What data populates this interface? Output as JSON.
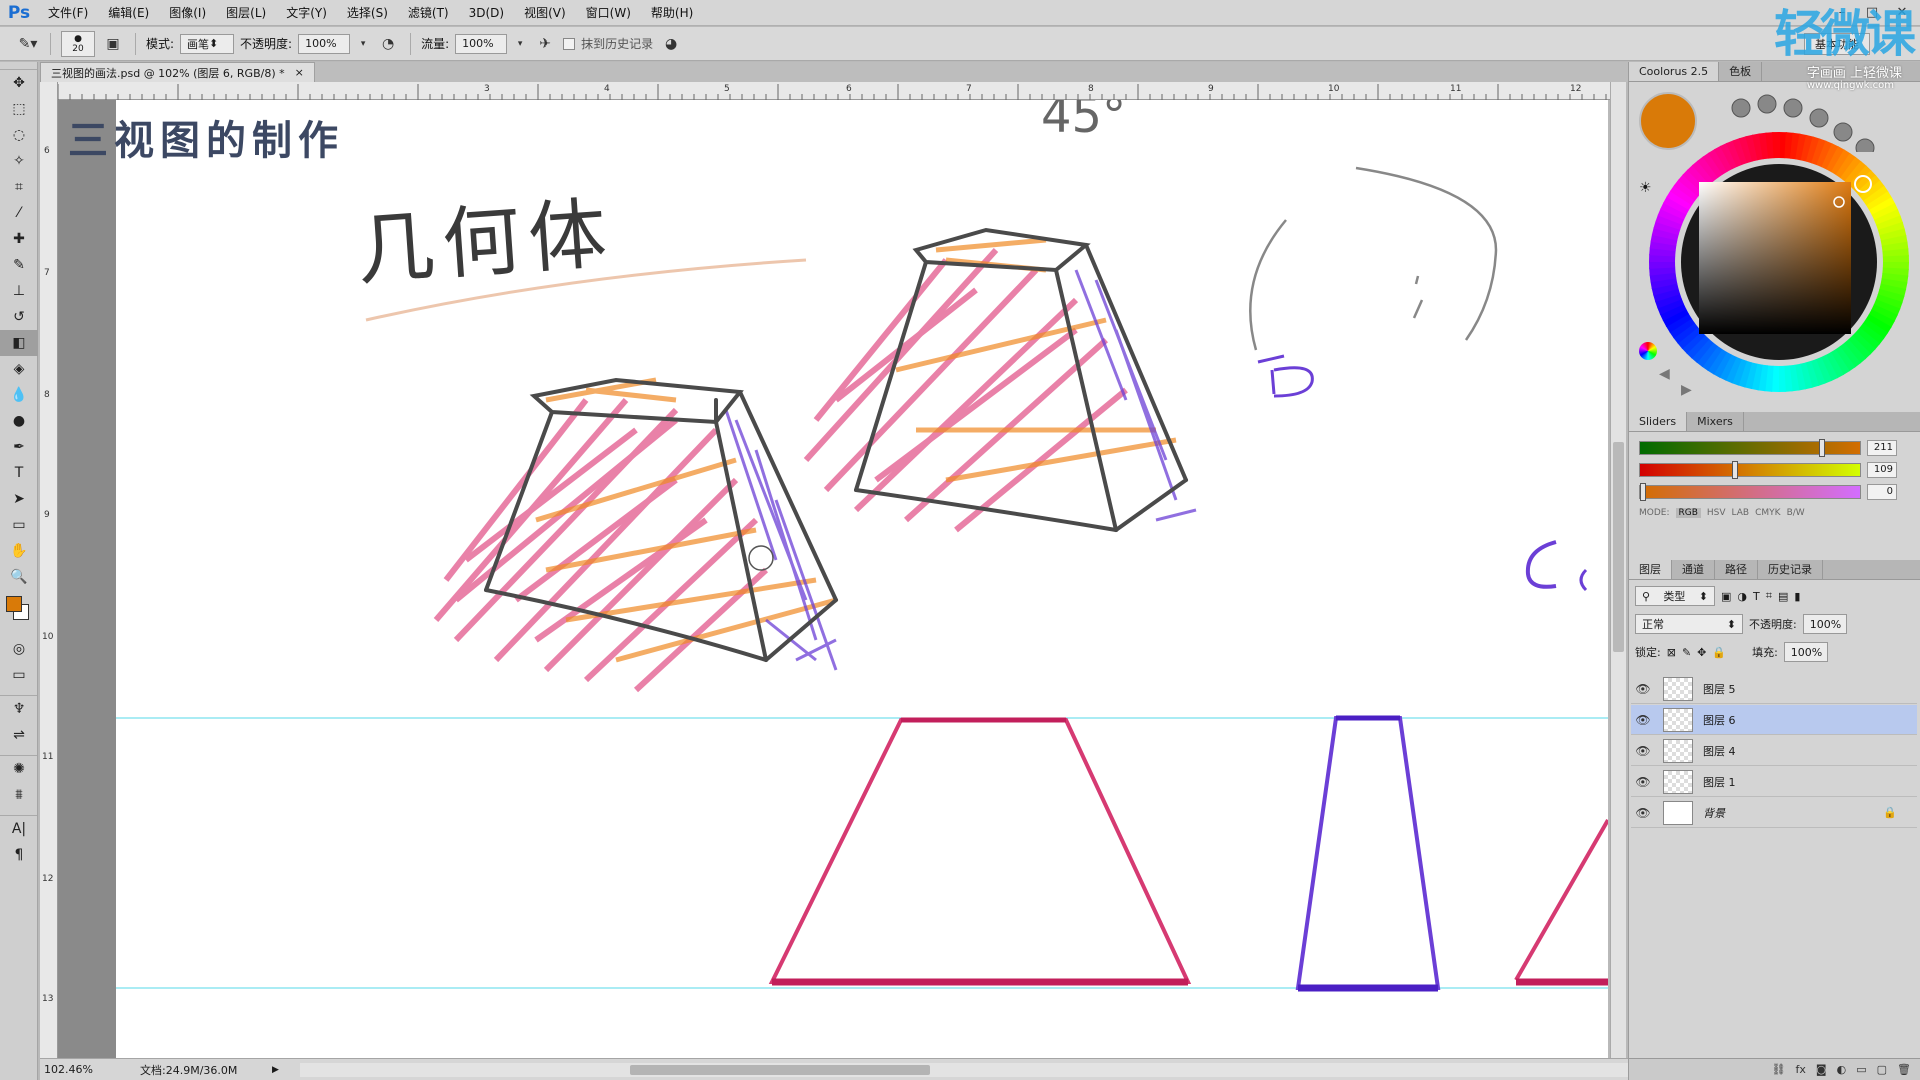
{
  "app": {
    "logo": "Ps"
  },
  "menu": [
    "文件(F)",
    "编辑(E)",
    "图像(I)",
    "图层(L)",
    "文字(Y)",
    "选择(S)",
    "滤镜(T)",
    "3D(D)",
    "视图(V)",
    "窗口(W)",
    "帮助(H)"
  ],
  "options": {
    "brush_size": "20",
    "mode_label": "模式:",
    "mode_value": "画笔",
    "opacity_label": "不透明度:",
    "opacity_value": "100%",
    "flow_label": "流量:",
    "flow_value": "100%",
    "history_label": "抹到历史记录",
    "workspace": "基本功能"
  },
  "document": {
    "tab_title": "三视图的画法.psd @ 102% (图层 6, RGB/8) *",
    "tab_close": "×",
    "page_title": "三视图的制作",
    "sketch_heading": "几何体",
    "angle_label": "45°"
  },
  "ruler": {
    "top": [
      "3",
      "4",
      "5",
      "6",
      "7",
      "8",
      "9",
      "10",
      "11",
      "12"
    ],
    "left": [
      "6",
      "7",
      "8",
      "9",
      "10",
      "11",
      "12",
      "13"
    ]
  },
  "status": {
    "zoom": "102.46%",
    "doc": "文档:24.9M/36.0M"
  },
  "coolorus": {
    "tabs": [
      "Coolorus 2.5",
      "色板"
    ],
    "current_color": "#d97a08",
    "sliders_tabs": [
      "Sliders",
      "Mixers"
    ],
    "r": 211,
    "g": 109,
    "b": 0,
    "r_text": "211",
    "g_text": "109",
    "b_text": "0",
    "modes": [
      "MODE:",
      "RGB",
      "HSV",
      "LAB",
      "CMYK",
      "B/W"
    ]
  },
  "layers_panel": {
    "tabs": [
      "图层",
      "通道",
      "路径",
      "历史记录"
    ],
    "filter_label": "类型",
    "blend_mode": "正常",
    "opacity_label": "不透明度:",
    "opacity_value": "100%",
    "lock_label": "锁定:",
    "fill_label": "填充:",
    "fill_value": "100%",
    "layers": [
      {
        "name": "图层 5",
        "selected": false
      },
      {
        "name": "图层 6",
        "selected": true
      },
      {
        "name": "图层 4",
        "selected": false
      },
      {
        "name": "图层 1",
        "selected": false
      },
      {
        "name": "背景",
        "selected": false,
        "locked": true
      }
    ]
  },
  "watermark": {
    "logo": "轻微课",
    "sub": "字画画 上轻微课",
    "url": "www.qingwk.com"
  },
  "colors": {
    "pink": "#d63a72",
    "orange": "#f08a24",
    "purple": "#6b3fd6",
    "guide": "#55d8e8"
  }
}
